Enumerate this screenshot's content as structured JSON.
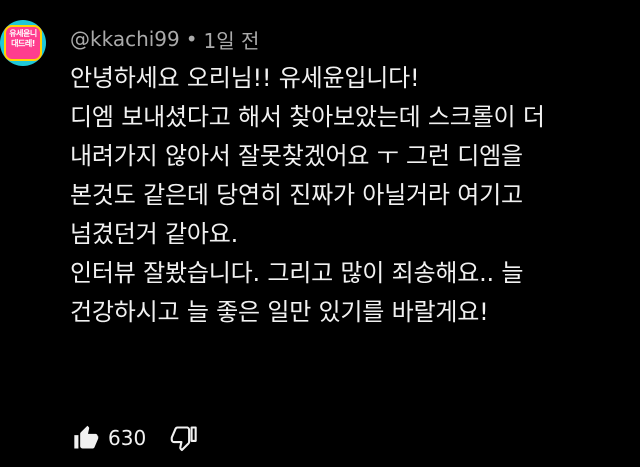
{
  "author": {
    "handle": "@kkachi99",
    "time": "1일 전",
    "separator": "•",
    "avatar_text": "유세윤니\n대드레!"
  },
  "comment": {
    "lines": [
      "안녕하세요 오리님!! 유세윤입니다!",
      "디엠 보내셨다고 해서 찾아보았는데 스크롤이 더",
      "내려가지 않아서 잘못찾겠어요 ㅜ 그런 디엠을",
      "본것도 같은데 당연히 진짜가 아닐거라 여기고",
      "넘겼던거 같아요.",
      "인터뷰 잘봤습니다. 그리고 많이 죄송해요.. 늘",
      "건강하시고 늘 좋은 일만 있기를 바랄게요!"
    ]
  },
  "actions": {
    "like_count": "630",
    "like_icon": "thumbs-up-icon",
    "dislike_icon": "thumbs-down-icon"
  },
  "colors": {
    "background": "#000000",
    "text": "#f1f1f1",
    "meta": "#aaaaaa",
    "avatar_ring": "#1fc7d8",
    "avatar_fill": "#ff3d8e"
  }
}
